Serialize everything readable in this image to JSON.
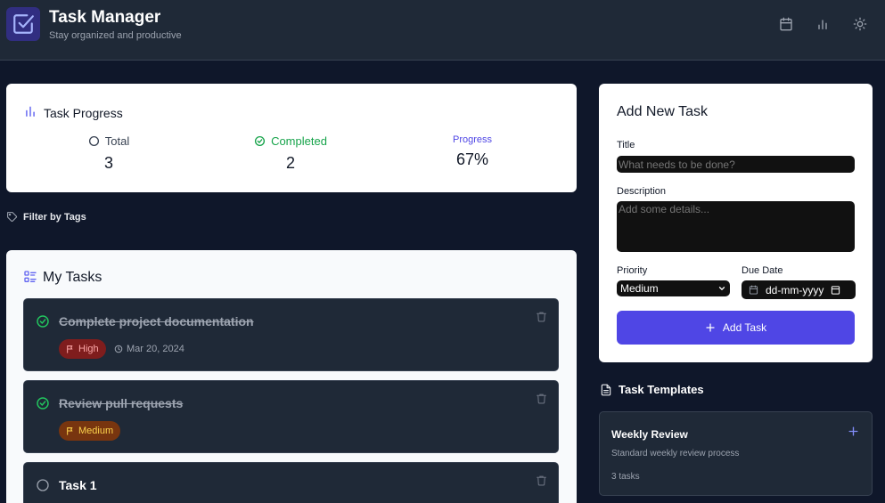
{
  "header": {
    "title": "Task Manager",
    "subtitle": "Stay organized and productive",
    "icons": [
      "check-square-icon",
      "calendar-icon",
      "bar-chart-icon",
      "sun-icon"
    ]
  },
  "progress": {
    "title": "Task Progress",
    "total_label": "Total",
    "total_value": "3",
    "completed_label": "Completed",
    "completed_value": "2",
    "progress_label": "Progress",
    "progress_value": "67%"
  },
  "filter": {
    "label": "Filter by Tags"
  },
  "tasks": {
    "title": "My Tasks",
    "items": [
      {
        "title": "Complete project documentation",
        "completed": true,
        "priority": "High",
        "due": "Mar 20, 2024"
      },
      {
        "title": "Review pull requests",
        "completed": true,
        "priority": "Medium"
      },
      {
        "title": "Task 1",
        "completed": false
      }
    ]
  },
  "add_task": {
    "heading": "Add New Task",
    "title_label": "Title",
    "title_placeholder": "What needs to be done?",
    "description_label": "Description",
    "description_placeholder": "Add some details...",
    "priority_label": "Priority",
    "priority_value": "Medium",
    "due_label": "Due Date",
    "due_placeholder": "dd-mm-yyyy",
    "button_label": "Add Task"
  },
  "templates": {
    "title": "Task Templates",
    "items": [
      {
        "name": "Weekly Review",
        "description": "Standard weekly review process",
        "count": "3 tasks"
      }
    ]
  },
  "colors": {
    "background": "#0f172a",
    "panel": "#1f2937",
    "accent": "#4f46e5",
    "success": "#22c55e",
    "priority_high": "#7f1d1d",
    "priority_medium": "#78350f"
  }
}
